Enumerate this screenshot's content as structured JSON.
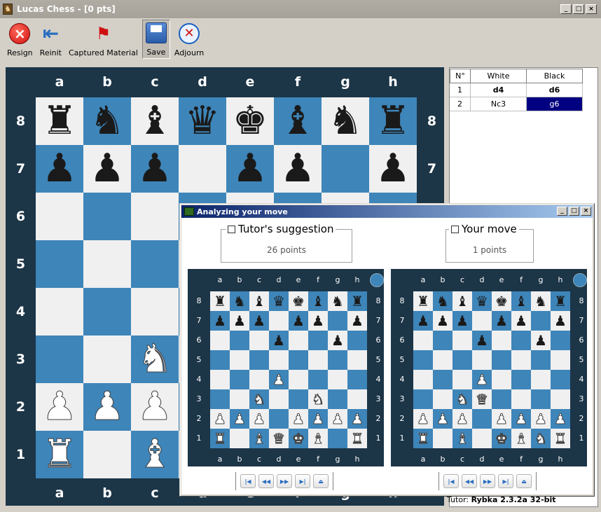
{
  "window": {
    "title": "Lucas Chess -  [0 pts]"
  },
  "toolbar": [
    {
      "id": "resign",
      "label": "Resign",
      "icon": "resign-icon"
    },
    {
      "id": "reinit",
      "label": "Reinit",
      "icon": "back-arrow-icon"
    },
    {
      "id": "captured",
      "label": "Captured Material",
      "icon": "captured-material-icon"
    },
    {
      "id": "save",
      "label": "Save",
      "icon": "floppy-disk-icon",
      "active": true
    },
    {
      "id": "adjourn",
      "label": "Adjourn",
      "icon": "clock-icon"
    }
  ],
  "board": {
    "files": [
      "a",
      "b",
      "c",
      "d",
      "e",
      "f",
      "g",
      "h"
    ],
    "ranks": [
      "8",
      "7",
      "6",
      "5",
      "4",
      "3",
      "2",
      "1"
    ],
    "position": [
      "rnbqkbnr",
      "ppp.pp.p",
      "........",
      "........",
      "........",
      "..N.....",
      "PPP.....",
      "R.B....."
    ],
    "light_color": "#f0f0f0",
    "dark_color": "#3e85b9",
    "frame_color": "#1c3547"
  },
  "movelist": {
    "headers": [
      "N°",
      "White",
      "Black"
    ],
    "rows": [
      {
        "n": "1",
        "white": "d4",
        "black": "d6"
      },
      {
        "n": "2",
        "white": "Nc3",
        "black": "g6",
        "selected": "black"
      }
    ],
    "selected_color": "#000080"
  },
  "tutor_label": "Tutor:",
  "tutor_engine": "Rybka 2.3.2a 32-bit",
  "dialog": {
    "title": "Analyzing your move",
    "suggestion": {
      "label": "Tutor's suggestion",
      "value": "26 points"
    },
    "yourmove": {
      "label": "Your move",
      "value": "1 points"
    },
    "left_position": [
      "rnbqkbnr",
      "ppp.pp.p",
      "...p..p.",
      "........",
      "...P....",
      "..N..N..",
      "PPP.PPPP",
      "R.BQKB.R"
    ],
    "right_position": [
      "rnbqkbnr",
      "ppp.pp.p",
      "...p..p.",
      "........",
      "...P....",
      "..NQ....",
      "PPP.PPPP",
      "R.B.KBNR"
    ]
  }
}
